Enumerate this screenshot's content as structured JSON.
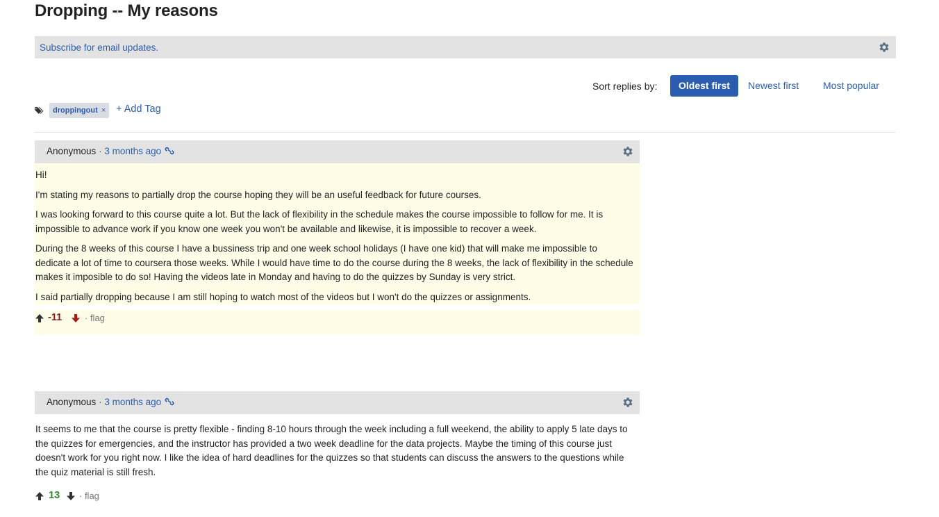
{
  "page": {
    "title": "Dropping -- My reasons"
  },
  "subscribe": {
    "label": "Subscribe for email updates."
  },
  "sort": {
    "label": "Sort replies by:",
    "options": [
      "Oldest first",
      "Newest first",
      "Most popular"
    ],
    "selected": "Oldest first"
  },
  "tags": {
    "items": [
      {
        "name": "droppingout",
        "remove": "×"
      }
    ],
    "add_label": "+ Add Tag"
  },
  "posts": [
    {
      "author": "Anonymous",
      "separator": "·",
      "time": "3 months ago",
      "paragraphs": [
        "Hi!",
        "I'm stating my reasons to partially drop the course hoping they will be an useful feedback for future courses.",
        "I was looking forward to this course quite a lot. But the lack of flexibility in the schedule makes the course impossible to follow for me. It is impossible to advance work if you know one week you won't be available and likewise, it is impossible to recover a week.",
        "During the 8 weeks of this course I have a bussiness trip and one week school holidays (I have one kid) that will make me impossible to dedicate a lot of time to coursera those weeks. While I would have time to do the course during the 8 weeks, the lack of flexibility in the schedule makes it imposible to do so! Having the videos late in Monday and having to do the quizzes by Sunday is very strict.",
        "I said partially dropping because I am still hoping to watch most of the videos but I won't do the quizzes or assignments."
      ],
      "score": "-11",
      "score_color": "#8b1a1a",
      "flag_label": "· flag"
    },
    {
      "author": "Anonymous",
      "separator": "·",
      "time": "3 months ago",
      "paragraphs": [
        "It seems to me that the course is pretty flexible - finding 8-10 hours through the week including a full weekend, the ability to apply 5 late days to the quizzes for emergencies, and the instructor has provided a two week deadline for the data projects. Maybe the timing of this course just doesn't work for you right now. I like the idea of hard deadlines for the quizzes so that students can discuss the answers to the questions while the quiz material is still fresh."
      ],
      "score": "13",
      "score_color": "#2e8b2e",
      "flag_label": "· flag"
    }
  ],
  "colors": {
    "link": "#2a5db0",
    "header_bg": "#e3e3e3",
    "highlight_bg": "#fffce8"
  }
}
